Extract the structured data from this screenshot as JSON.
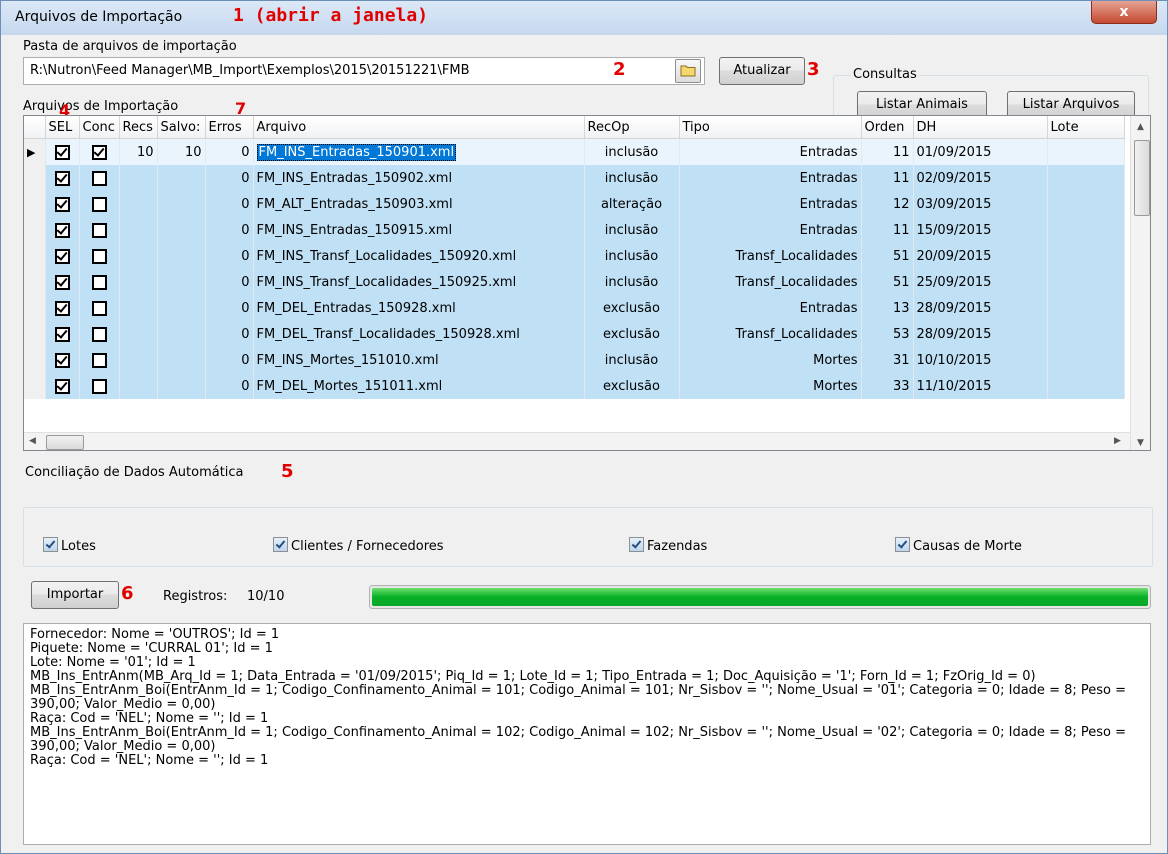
{
  "window": {
    "title": "Arquivos de Importação",
    "title_annotation": "1 (abrir a janela)",
    "close_label": "x"
  },
  "folder": {
    "label": "Pasta de arquivos de importação",
    "path": "R:\\Nutron\\Feed Manager\\MB_Import\\Exemplos\\2015\\20151221\\FMB",
    "annotation": "2",
    "folder_icon": "folder-icon",
    "refresh_label": "Atualizar",
    "refresh_annotation": "3"
  },
  "consultas": {
    "label": "Consultas",
    "animals_label": "Listar Animais",
    "files_label": "Listar Arquivos"
  },
  "grid": {
    "label": "Arquivos de Importação",
    "annotation_sel": "4",
    "annotation_erros": "7",
    "columns": [
      "SEL",
      "Conc",
      "Recs",
      "Salvo:",
      "Erros",
      "Arquivo",
      "RecOp",
      "Tipo",
      "Orden",
      "DH",
      "Lote"
    ],
    "rows": [
      {
        "sel": true,
        "conc": true,
        "recs": "10",
        "salvos": "10",
        "erros": "0",
        "arquivo": "FM_INS_Entradas_150901.xml",
        "recop": "inclusão",
        "tipo": "Entradas",
        "ordem": "11",
        "dh": "01/09/2015",
        "lote": ""
      },
      {
        "sel": true,
        "conc": false,
        "recs": "",
        "salvos": "",
        "erros": "0",
        "arquivo": "FM_INS_Entradas_150902.xml",
        "recop": "inclusão",
        "tipo": "Entradas",
        "ordem": "11",
        "dh": "02/09/2015",
        "lote": ""
      },
      {
        "sel": true,
        "conc": false,
        "recs": "",
        "salvos": "",
        "erros": "0",
        "arquivo": "FM_ALT_Entradas_150903.xml",
        "recop": "alteração",
        "tipo": "Entradas",
        "ordem": "12",
        "dh": "03/09/2015",
        "lote": ""
      },
      {
        "sel": true,
        "conc": false,
        "recs": "",
        "salvos": "",
        "erros": "0",
        "arquivo": "FM_INS_Entradas_150915.xml",
        "recop": "inclusão",
        "tipo": "Entradas",
        "ordem": "11",
        "dh": "15/09/2015",
        "lote": ""
      },
      {
        "sel": true,
        "conc": false,
        "recs": "",
        "salvos": "",
        "erros": "0",
        "arquivo": "FM_INS_Transf_Localidades_150920.xml",
        "recop": "inclusão",
        "tipo": "Transf_Localidades",
        "ordem": "51",
        "dh": "20/09/2015",
        "lote": ""
      },
      {
        "sel": true,
        "conc": false,
        "recs": "",
        "salvos": "",
        "erros": "0",
        "arquivo": "FM_INS_Transf_Localidades_150925.xml",
        "recop": "inclusão",
        "tipo": "Transf_Localidades",
        "ordem": "51",
        "dh": "25/09/2015",
        "lote": ""
      },
      {
        "sel": true,
        "conc": false,
        "recs": "",
        "salvos": "",
        "erros": "0",
        "arquivo": "FM_DEL_Entradas_150928.xml",
        "recop": "exclusão",
        "tipo": "Entradas",
        "ordem": "13",
        "dh": "28/09/2015",
        "lote": ""
      },
      {
        "sel": true,
        "conc": false,
        "recs": "",
        "salvos": "",
        "erros": "0",
        "arquivo": "FM_DEL_Transf_Localidades_150928.xml",
        "recop": "exclusão",
        "tipo": "Transf_Localidades",
        "ordem": "53",
        "dh": "28/09/2015",
        "lote": ""
      },
      {
        "sel": true,
        "conc": false,
        "recs": "",
        "salvos": "",
        "erros": "0",
        "arquivo": "FM_INS_Mortes_151010.xml",
        "recop": "inclusão",
        "tipo": "Mortes",
        "ordem": "31",
        "dh": "10/10/2015",
        "lote": ""
      },
      {
        "sel": true,
        "conc": false,
        "recs": "",
        "salvos": "",
        "erros": "0",
        "arquivo": "FM_DEL_Mortes_151011.xml",
        "recop": "exclusão",
        "tipo": "Mortes",
        "ordem": "33",
        "dh": "11/10/2015",
        "lote": ""
      }
    ]
  },
  "conciliacao": {
    "label": "Conciliação de Dados Automática",
    "annotation": "5",
    "options": [
      {
        "label": "Lotes",
        "checked": true
      },
      {
        "label": "Clientes / Fornecedores",
        "checked": true
      },
      {
        "label": "Fazendas",
        "checked": true
      },
      {
        "label": "Causas de Morte",
        "checked": true
      }
    ]
  },
  "import": {
    "button_label": "Importar",
    "annotation": "6",
    "registros_label": "Registros:",
    "registros_value": "10/10",
    "progress": 1.0
  },
  "log": {
    "lines": [
      "Fornecedor: Nome = 'OUTROS'; Id = 1",
      "Piquete: Nome = 'CURRAL 01'; Id = 1",
      "Lote: Nome = '01'; Id = 1",
      "MB_Ins_EntrAnm(MB_Arq_Id = 1; Data_Entrada = '01/09/2015'; Piq_Id = 1; Lote_Id = 1; Tipo_Entrada = 1; Doc_Aquisição = '1'; Forn_Id = 1; FzOrig_Id = 0)",
      "MB_Ins_EntrAnm_Boi(EntrAnm_Id = 1; Codigo_Confinamento_Animal = 101; Codigo_Animal = 101; Nr_Sisbov = ''; Nome_Usual = '01'; Categoria = 0; Idade = 8; Peso = 390,00; Valor_Medio = 0,00)",
      "Raça: Cod = 'NEL'; Nome = ''; Id = 1",
      "MB_Ins_EntrAnm_Boi(EntrAnm_Id = 1; Codigo_Confinamento_Animal = 102; Codigo_Animal = 102; Nr_Sisbov = ''; Nome_Usual = '02'; Categoria = 0; Idade = 8; Peso = 390,00; Valor_Medio = 0,00)",
      "Raça: Cod = 'NEL'; Nome = ''; Id = 1"
    ]
  },
  "colors": {
    "row_selected": "#bfe0f5",
    "annotation": "#e10000",
    "progress": "#06b025"
  }
}
